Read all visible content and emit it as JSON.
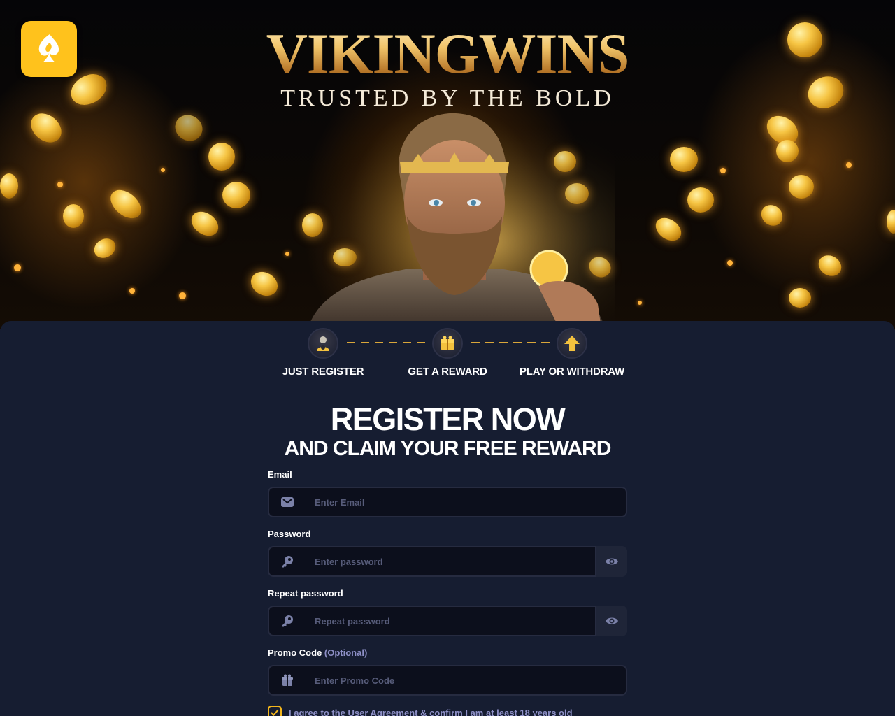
{
  "brand": {
    "title": "VIKINGWINS",
    "tagline": "TRUSTED BY THE BOLD",
    "logo_icon": "spade-flame-icon",
    "accent_color": "#ffc21c"
  },
  "steps": [
    {
      "label": "JUST REGISTER",
      "icon": "user-icon"
    },
    {
      "label": "GET A REWARD",
      "icon": "gift-icon"
    },
    {
      "label": "PLAY OR WITHDRAW",
      "icon": "arrow-up-icon"
    }
  ],
  "register": {
    "title": "REGISTER NOW",
    "subtitle": "AND CLAIM YOUR FREE REWARD"
  },
  "form": {
    "email": {
      "label": "Email",
      "placeholder": "Enter Email",
      "value": ""
    },
    "password": {
      "label": "Password",
      "placeholder": "Enter password",
      "value": ""
    },
    "repeat_password": {
      "label": "Repeat password",
      "placeholder": "Repeat password",
      "value": ""
    },
    "promo": {
      "label": "Promo Code",
      "optional": "(Optional)",
      "placeholder": "Enter Promo Code",
      "value": ""
    },
    "agree": {
      "text": "I agree to the User Agreement & confirm I am at least 18 years old",
      "checked": true
    }
  },
  "colors": {
    "panel_bg": "#161d31",
    "input_bg": "#0c0f1c",
    "muted_text": "#8e90c7",
    "gold": "#d9a63a"
  }
}
